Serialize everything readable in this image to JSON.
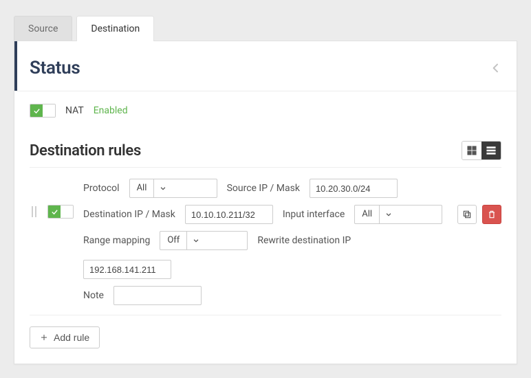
{
  "tabs": {
    "source": "Source",
    "destination": "Destination",
    "active": "destination"
  },
  "status": {
    "title": "Status"
  },
  "nat": {
    "label": "NAT",
    "status_text": "Enabled",
    "enabled": true
  },
  "rules": {
    "title": "Destination rules",
    "add_label": "Add rule",
    "items": [
      {
        "enabled": true,
        "protocol_label": "Protocol",
        "protocol_value": "All",
        "sourceip_label": "Source IP / Mask",
        "sourceip_value": "10.20.30.0/24",
        "destip_label": "Destination IP / Mask",
        "destip_value": "10.10.10.211/32",
        "iface_label": "Input interface",
        "iface_value": "All",
        "range_label": "Range mapping",
        "range_value": "Off",
        "rewrite_label": "Rewrite destination IP",
        "rewrite_value": "192.168.141.211",
        "note_label": "Note",
        "note_value": ""
      }
    ]
  }
}
